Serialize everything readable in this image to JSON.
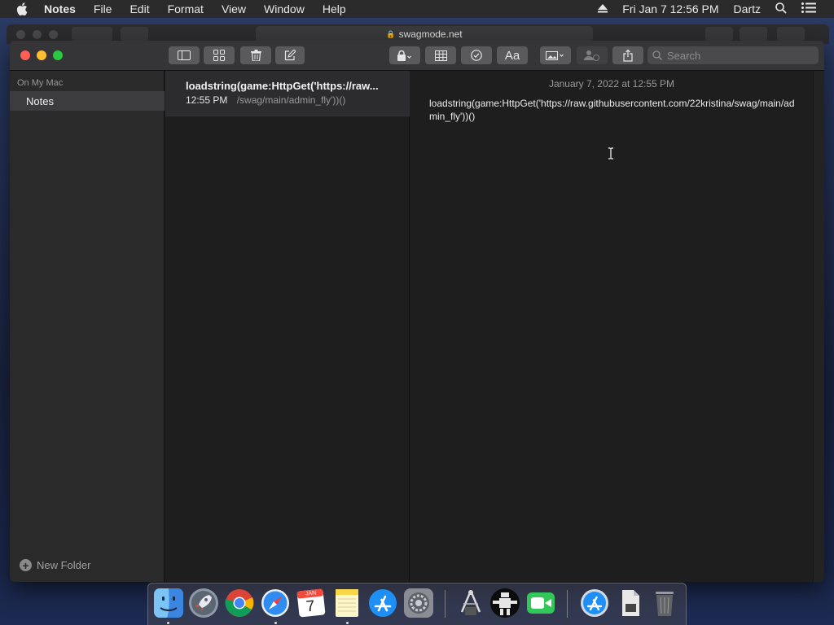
{
  "menubar": {
    "app_name": "Notes",
    "menus": [
      "File",
      "Edit",
      "Format",
      "View",
      "Window",
      "Help"
    ],
    "datetime": "Fri Jan 7  12:56 PM",
    "user": "Dartz"
  },
  "background_window": {
    "url": "swagmode.net"
  },
  "toolbar": {
    "search_placeholder": "Search"
  },
  "sidebar": {
    "section": "On My Mac",
    "folders": [
      {
        "label": "Notes",
        "selected": true
      }
    ],
    "new_folder_label": "New Folder"
  },
  "note_list": {
    "items": [
      {
        "title": "loadstring(game:HttpGet('https://raw...",
        "time": "12:55 PM",
        "preview": "/swag/main/admin_fly'))()",
        "selected": true
      }
    ]
  },
  "editor": {
    "date": "January 7, 2022 at 12:55 PM",
    "body": "loadstring(game:HttpGet('https://raw.githubusercontent.com/22kristina/swag/main/admin_fly'))()"
  },
  "dock": {
    "apps": [
      "finder-icon",
      "launchpad-icon",
      "chrome-icon",
      "safari-icon",
      "calendar-icon",
      "notes-icon",
      "app-store-icon",
      "system-preferences-icon",
      "xcode-tool-icon",
      "robot-tool-icon",
      "facetime-icon",
      "app-store-downloads-icon",
      "document-icon",
      "trash-icon"
    ],
    "calendar_month": "JAN",
    "calendar_day": "7"
  },
  "colors": {
    "close": "#ff5f57",
    "minimize": "#febc2e",
    "maximize": "#28c840",
    "window_bg": "#1e1e1e",
    "sidebar_bg": "#2a2a2b"
  }
}
